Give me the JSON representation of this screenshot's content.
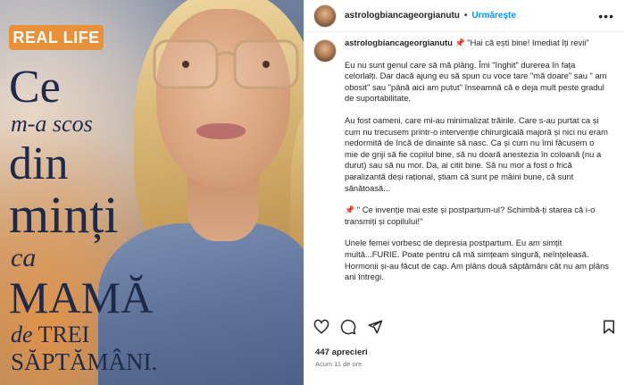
{
  "image": {
    "badge": "REAL LIFE",
    "headline": {
      "line1": "Ce",
      "line2": "m-a scos",
      "line3": "din",
      "line4": "minți",
      "line5": "ca",
      "line6": "MAMĂ",
      "line7_italic": "de",
      "line7_rest": " TREI",
      "line8": "SĂPTĂMÂNI."
    },
    "colors": {
      "badge": "#e8913a",
      "headline": "#1e2a4a"
    }
  },
  "header": {
    "username": "astrologbiancageorgianutu",
    "separator": "•",
    "follow_label": "Urmărește",
    "more_icon": "more-horizontal-icon"
  },
  "caption": {
    "username": "astrologbiancageorgianutu",
    "pin_icon": "📌",
    "first_line": " \"Hai că ești bine! Imediat îți revii\"",
    "p1": "Eu nu sunt genul care să mă plâng. Îmi \"înghit\" durerea în fața celorlalți. Dar dacă ajung eu să spun cu voce tare \"mă doare\" sau \" am obosit\" sau \"până aici am putut\" înseamnă că e deja mult peste gradul de suportabilitate.",
    "p2": "Au fost oameni, care mi-au minimalizat trăirile. Care s-au purtat ca și cum nu trecusem printr-o intervenție chirurgicală majoră și nici nu eram nedormită de încă de dinainte să nasc. Ca și cum nu îmi făcusem o mie de griji să fie copilul bine, să nu doară anestezia în coloană (nu a durut) sau să nu mor. Da, ai citit bine. Să nu mor a fost o frică paralizantă deși rațional, știam că sunt pe mâini bune, că sunt sănătoasă...",
    "p3_pin": "📌",
    "p3": " \" Ce invenție mai este și postpartum-ul? Schimbă-ți starea că i-o transmiți și copilului!\"",
    "p4": "Unele femei vorbesc de depresia postpartum. Eu am simțit multă...FURIE. Poate pentru că mă simțeam singură, neînțeleasă. Hormonii și-au făcut de cap. Am plâns două săptămâni cât nu am plâns ani întregi."
  },
  "actions": {
    "like_icon": "heart-icon",
    "comment_icon": "comment-icon",
    "share_icon": "share-icon",
    "save_icon": "bookmark-icon"
  },
  "likes": "447 aprecieri",
  "timestamp": "Acum 11 de ore",
  "colors": {
    "follow": "#0095f6",
    "text": "#262626",
    "muted": "#737373"
  }
}
